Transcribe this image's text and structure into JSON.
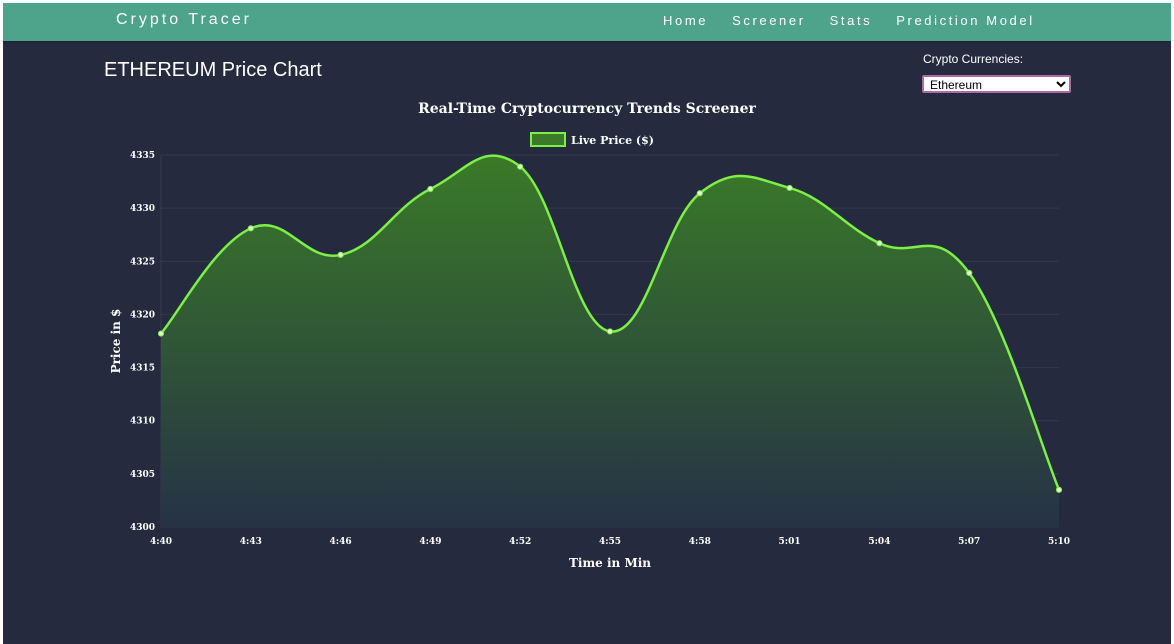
{
  "navbar": {
    "brand": "Crypto Tracer",
    "links": [
      "Home",
      "Screener",
      "Stats",
      "Prediction Model"
    ]
  },
  "page": {
    "title": "ETHEREUM Price Chart"
  },
  "selector": {
    "label": "Crypto Currencies:",
    "selected": "Ethereum"
  },
  "colors": {
    "navbar": "#4da48a",
    "background": "#252a3e",
    "line": "#7cf046",
    "fill_top": "#3a7a28",
    "fill_bottom": "#263245",
    "select_border": "#b06aa4"
  },
  "chart_data": {
    "type": "area",
    "title": "Real-Time Cryptocurrency Trends Screener",
    "xlabel": "Time in Min",
    "ylabel": "Price in $",
    "legend": "Live Price ($)",
    "legend_position": "top-center",
    "grid": true,
    "ylim": [
      4300,
      4335
    ],
    "yticks": [
      4300,
      4305,
      4310,
      4315,
      4320,
      4325,
      4330,
      4335
    ],
    "x": [
      "4:40",
      "4:43",
      "4:46",
      "4:49",
      "4:52",
      "4:55",
      "4:58",
      "5:01",
      "5:04",
      "5:07",
      "5:10"
    ],
    "values": [
      4318.2,
      4328.1,
      4325.6,
      4331.8,
      4333.9,
      4318.4,
      4331.4,
      4331.9,
      4326.7,
      4323.9,
      4303.5
    ]
  }
}
